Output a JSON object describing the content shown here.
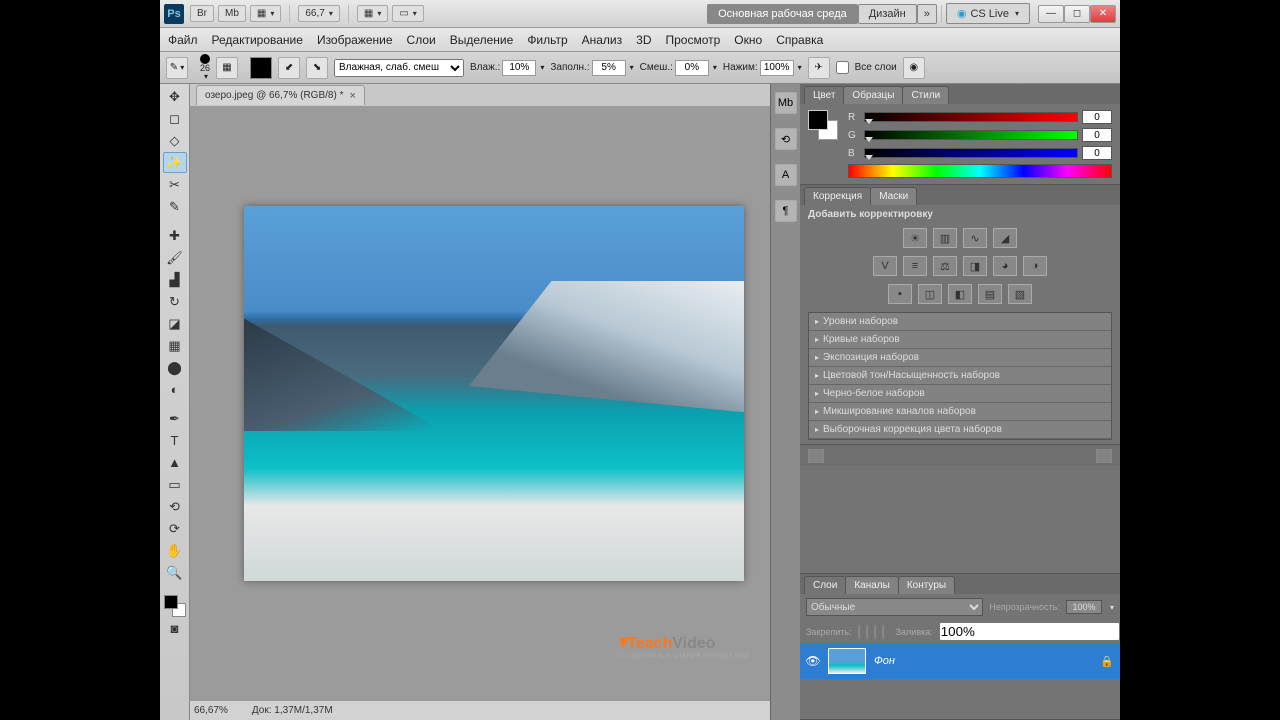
{
  "titlebar": {
    "zoom_display": "66,7",
    "workspace_main": "Основная рабочая среда",
    "workspace_design": "Дизайн",
    "cslive": "CS Live"
  },
  "menu": [
    "Файл",
    "Редактирование",
    "Изображение",
    "Слои",
    "Выделение",
    "Фильтр",
    "Анализ",
    "3D",
    "Просмотр",
    "Окно",
    "Справка"
  ],
  "options": {
    "brush_size": "26",
    "mode_label": "Влажная, слаб. смеш",
    "wet_label": "Влаж.:",
    "wet_value": "10%",
    "load_label": "Заполн.:",
    "load_value": "5%",
    "mix_label": "Смеш.:",
    "mix_value": "0%",
    "flow_label": "Нажим:",
    "flow_value": "100%",
    "all_layers": "Все слои"
  },
  "doc_tab": "озеро.jpeg @ 66,7% (RGB/8) *",
  "status": {
    "zoom": "66,67%",
    "doc": "Док: 1,37M/1,37M"
  },
  "color_panel": {
    "tabs": [
      "Цвет",
      "Образцы",
      "Стили"
    ],
    "channels": {
      "r_label": "R",
      "g_label": "G",
      "b_label": "B",
      "r": "0",
      "g": "0",
      "b": "0"
    }
  },
  "adjust_panel": {
    "tabs": [
      "Коррекция",
      "Маски"
    ],
    "add_label": "Добавить корректировку",
    "presets": [
      "Уровни наборов",
      "Кривые наборов",
      "Экспозиция наборов",
      "Цветовой тон/Насыщенность наборов",
      "Черно-белое наборов",
      "Микширование каналов наборов",
      "Выборочная коррекция цвета наборов"
    ]
  },
  "layers_panel": {
    "tabs": [
      "Слои",
      "Каналы",
      "Контуры"
    ],
    "blend_mode": "Обычные",
    "opacity_label": "Непрозрачность:",
    "opacity": "100%",
    "lock_label": "Закрепить:",
    "fill_label": "Заливка:",
    "fill": "100%",
    "layer_name": "Фон"
  },
  "watermark": {
    "brand1": "Teach",
    "brand2": "Video",
    "sub": "ПОСМОТРИ КАК ЗНАНИЯ МЕНЯЮТ МИР"
  }
}
